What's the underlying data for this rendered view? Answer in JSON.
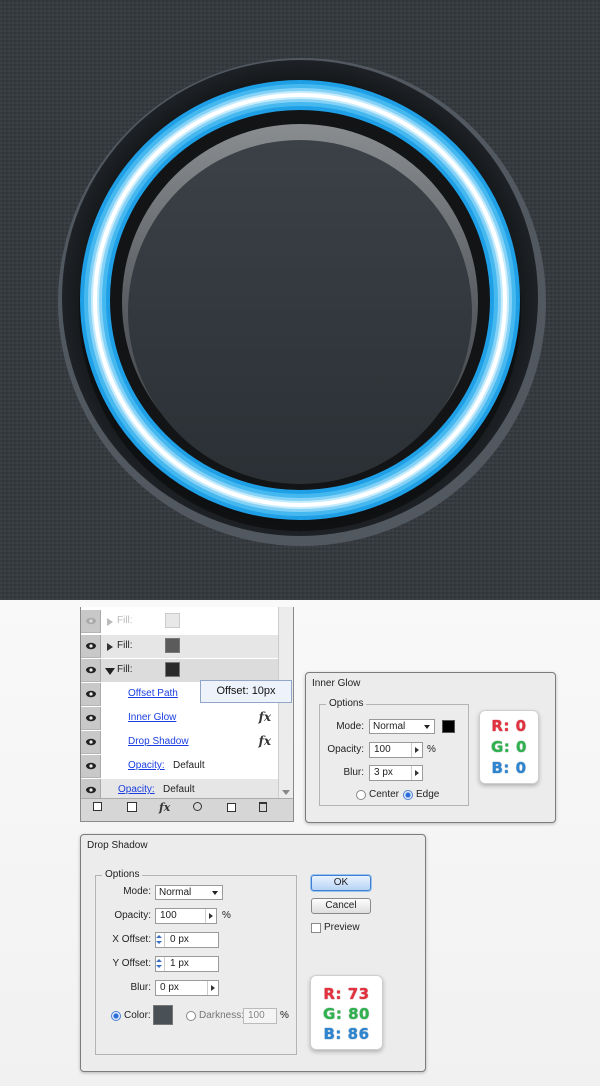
{
  "appearance_panel": {
    "rows": [
      {
        "label": "Fill:",
        "state": "faded"
      },
      {
        "label": "Fill:",
        "state": "collapsed"
      },
      {
        "label": "Fill:",
        "state": "expanded"
      }
    ],
    "effects": [
      {
        "label": "Offset Path",
        "fx": ""
      },
      {
        "label": "Inner Glow",
        "fx": "fx"
      },
      {
        "label": "Drop Shadow",
        "fx": "fx"
      }
    ],
    "inner_opacity_label": "Opacity:",
    "inner_opacity_value": "Default",
    "bottom_opacity_label": "Opacity:",
    "bottom_opacity_value": "Default",
    "fx_menu_label": "fx",
    "tooltip": "Offset: 10px",
    "fill_colors": [
      "#d0d0d0",
      "#5b5b5b",
      "#2b2b2b"
    ]
  },
  "inner_glow": {
    "title": "Inner Glow",
    "group_label": "Options",
    "mode_label": "Mode:",
    "mode_value": "Normal",
    "color_swatch": "#000000",
    "opacity_label": "Opacity:",
    "opacity_value": "100",
    "opacity_unit": "%",
    "blur_label": "Blur:",
    "blur_value": "3 px",
    "radio_center": "Center",
    "radio_edge": "Edge",
    "rgb": {
      "r": "R: 0",
      "g": "G: 0",
      "b": "B: 0"
    }
  },
  "drop_shadow": {
    "title": "Drop Shadow",
    "group_label": "Options",
    "mode_label": "Mode:",
    "mode_value": "Normal",
    "opacity_label": "Opacity:",
    "opacity_value": "100",
    "opacity_unit": "%",
    "x_offset_label": "X Offset:",
    "x_offset_value": "0 px",
    "y_offset_label": "Y Offset:",
    "y_offset_value": "1 px",
    "blur_label": "Blur:",
    "blur_value": "0 px",
    "color_label": "Color:",
    "color_swatch": "#495056",
    "darkness_label": "Darkness:",
    "darkness_value": "100",
    "darkness_unit": "%",
    "ok_label": "OK",
    "cancel_label": "Cancel",
    "preview_label": "Preview",
    "rgb": {
      "r": "R: 73",
      "g": "G: 80",
      "b": "B: 86"
    }
  },
  "colors": {
    "background": "#33383d",
    "ring_outer": "#1ea0e6",
    "ring_glow": "#ffffff"
  }
}
